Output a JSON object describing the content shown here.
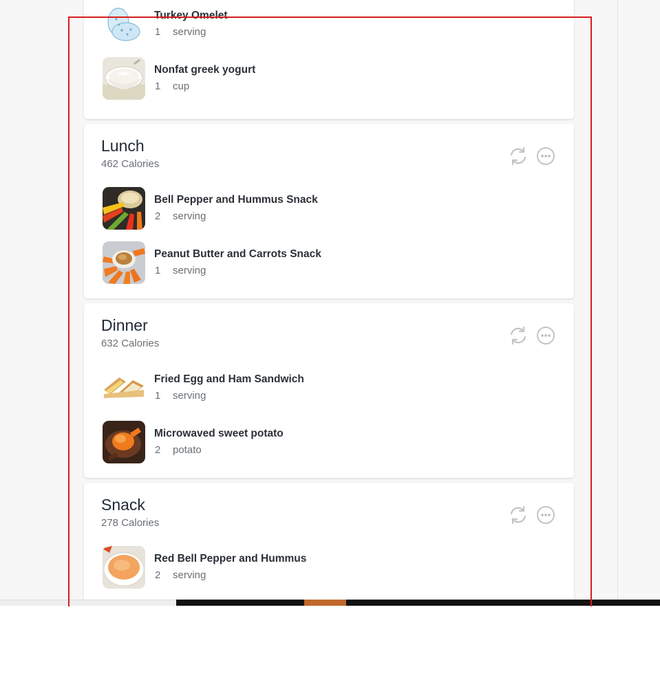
{
  "colors": {
    "accent_box": "#d71d1d",
    "card": "#ffffff",
    "page": "#f7f7f7",
    "title": "#1f2a36",
    "muted": "#6a6f75"
  },
  "meals": [
    {
      "title": "",
      "calories": "",
      "items": [
        {
          "name": "Turkey Omelet",
          "amount": "1",
          "unit": "serving",
          "thumb_icon": "omelet-egg-icon"
        },
        {
          "name": "Nonfat greek yogurt",
          "amount": "1",
          "unit": "cup",
          "thumb_icon": "yogurt-bowl-photo"
        }
      ]
    },
    {
      "title": "Lunch",
      "calories": "462 Calories",
      "items": [
        {
          "name": "Bell Pepper and Hummus Snack",
          "amount": "2",
          "unit": "serving",
          "thumb_icon": "bell-pepper-hummus-photo"
        },
        {
          "name": "Peanut Butter and Carrots Snack",
          "amount": "1",
          "unit": "serving",
          "thumb_icon": "peanut-butter-carrots-photo"
        }
      ]
    },
    {
      "title": "Dinner",
      "calories": "632 Calories",
      "items": [
        {
          "name": "Fried Egg and Ham Sandwich",
          "amount": "1",
          "unit": "serving",
          "thumb_icon": "egg-ham-sandwich-photo"
        },
        {
          "name": "Microwaved sweet potato",
          "amount": "2",
          "unit": "potato",
          "thumb_icon": "sweet-potato-photo"
        }
      ]
    },
    {
      "title": "Snack",
      "calories": "278 Calories",
      "items": [
        {
          "name": "Red Bell Pepper and Hummus",
          "amount": "2",
          "unit": "serving",
          "thumb_icon": "red-pepper-hummus-photo"
        }
      ]
    }
  ],
  "actions": {
    "regenerate_icon": "refresh-icon",
    "more_icon": "more-options-icon"
  }
}
